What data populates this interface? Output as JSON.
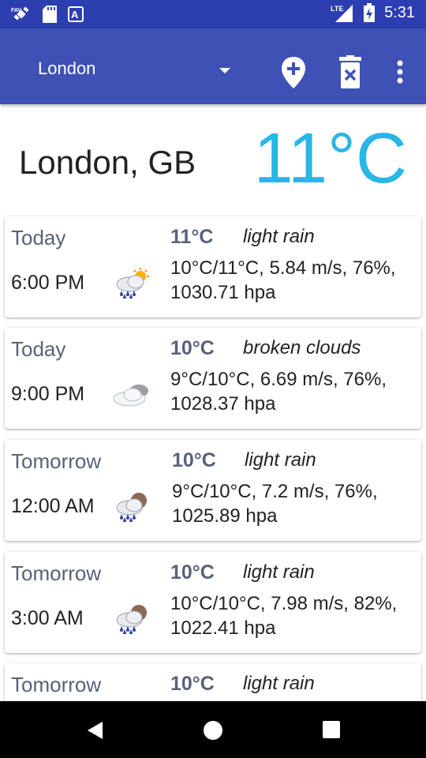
{
  "status_bar": {
    "time": "5:31",
    "network": "LTE",
    "left_icons": [
      "satellite-icon",
      "sd-card-icon",
      "keyboard-icon"
    ]
  },
  "app_bar": {
    "city": "London",
    "icons": [
      "add-location-icon",
      "delete-icon",
      "overflow-menu-icon"
    ]
  },
  "current": {
    "location": "London, GB",
    "temperature": "11°C"
  },
  "forecast": [
    {
      "day": "Today",
      "time": "6:00 PM",
      "temp": "11°C",
      "desc": "light rain",
      "details": "10°C/11°C, 5.84 m/s, 76%, 1030.71 hpa",
      "icon": "rain-sun-icon"
    },
    {
      "day": "Today",
      "time": "9:00 PM",
      "temp": "10°C",
      "desc": "broken clouds",
      "details": "9°C/10°C, 6.69 m/s, 76%, 1028.37 hpa",
      "icon": "broken-clouds-icon"
    },
    {
      "day": "Tomorrow",
      "time": "12:00 AM",
      "temp": "10°C",
      "desc": "light rain",
      "details": "9°C/10°C, 7.2 m/s, 76%, 1025.89 hpa",
      "icon": "rain-moon-icon"
    },
    {
      "day": "Tomorrow",
      "time": "3:00 AM",
      "temp": "10°C",
      "desc": "light rain",
      "details": "10°C/10°C, 7.98 m/s, 82%, 1022.41 hpa",
      "icon": "rain-moon-icon"
    },
    {
      "day": "Tomorrow",
      "time": "",
      "temp": "10°C",
      "desc": "light rain",
      "details": "",
      "icon": ""
    }
  ],
  "nav_bar": {
    "buttons": [
      "back-icon",
      "home-icon",
      "recents-icon"
    ]
  },
  "colors": {
    "status_bar": "#2d3eb0",
    "app_bar": "#3f51b5",
    "accent_temp": "#29b6e6",
    "muted_text": "#5a6079"
  }
}
